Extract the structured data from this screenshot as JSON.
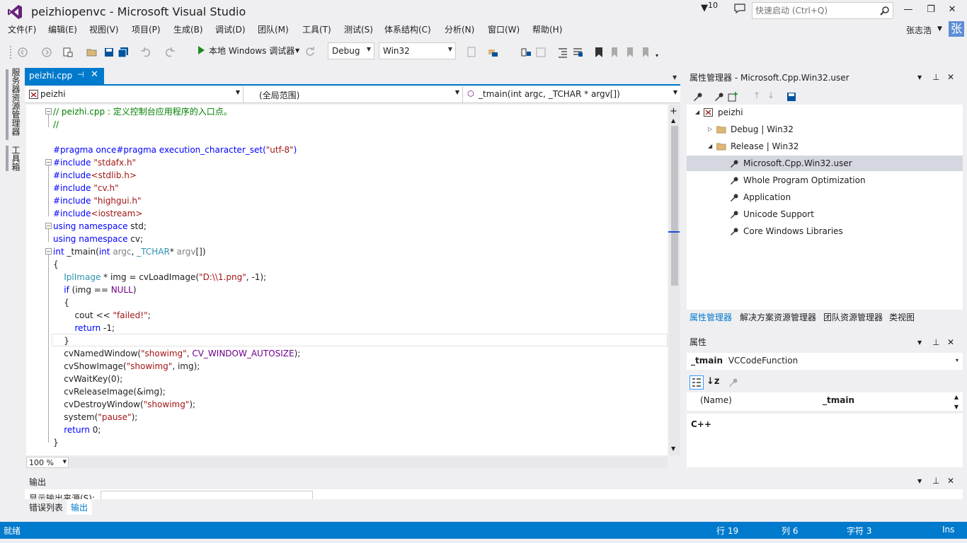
{
  "window": {
    "title": "peizhiopenvc - Microsoft Visual Studio",
    "notification_count": "10",
    "quick_launch_placeholder": "快速启动 (Ctrl+Q)",
    "user_name": "张志浩",
    "avatar_text": "张",
    "min_label": "—",
    "max_label": "❐",
    "close_label": "✕"
  },
  "menu": {
    "items": [
      "文件(F)",
      "编辑(E)",
      "视图(V)",
      "项目(P)",
      "生成(B)",
      "调试(D)",
      "团队(M)",
      "工具(T)",
      "测试(S)",
      "体系结构(C)",
      "分析(N)",
      "窗口(W)",
      "帮助(H)"
    ]
  },
  "toolbar": {
    "start_label": "本地 Windows 调试器",
    "configuration": "Debug",
    "platform": "Win32"
  },
  "left_tabs": [
    "服务器资源管理器",
    "工具箱"
  ],
  "document": {
    "tab_label": "peizhi.cpp",
    "pin_glyph": "⊣",
    "close_glyph": "✕",
    "nav_project": "peizhi",
    "nav_scope": "(全局范围)",
    "nav_member": "_tmain(int argc, _TCHAR * argv[])",
    "zoom": "100 %",
    "split_glyph": "+"
  },
  "code_lines": [
    [
      [
        "cm",
        "// peizhi.cpp : 定义控制台应用程序的入口点。"
      ]
    ],
    [
      [
        "cm",
        "//"
      ]
    ],
    [],
    [
      [
        "pp",
        "#pragma once"
      ],
      [
        "pp",
        "#pragma execution_character_set("
      ],
      [
        "str",
        "\"utf-8\""
      ],
      [
        "pp",
        ")"
      ]
    ],
    [
      [
        "pp",
        "#include "
      ],
      [
        "str",
        "\"stdafx.h\""
      ]
    ],
    [
      [
        "pp",
        "#include"
      ],
      [
        "str",
        "<stdlib.h>"
      ]
    ],
    [
      [
        "pp",
        "#include "
      ],
      [
        "str",
        "\"cv.h\""
      ]
    ],
    [
      [
        "pp",
        "#include "
      ],
      [
        "str",
        "\"highgui.h\""
      ]
    ],
    [
      [
        "pp",
        "#include"
      ],
      [
        "str",
        "<iostream>"
      ]
    ],
    [
      [
        "kw",
        "using namespace "
      ],
      [
        "",
        "std;"
      ]
    ],
    [
      [
        "kw",
        "using namespace "
      ],
      [
        "",
        "cv;"
      ]
    ],
    [
      [
        "kw",
        "int "
      ],
      [
        "",
        "_tmain("
      ],
      [
        "kw",
        "int "
      ],
      [
        "pm",
        "argc"
      ],
      [
        "",
        ", "
      ],
      [
        "ty",
        "_TCHAR"
      ],
      [
        "",
        "* "
      ],
      [
        "pm",
        "argv"
      ],
      [
        "",
        "[])"
      ]
    ],
    [
      [
        "",
        "{"
      ]
    ],
    [
      [
        "ty",
        "    IplImage"
      ],
      [
        "",
        " * img = cvLoadImage("
      ],
      [
        "str",
        "\"D:\\\\1.png\""
      ],
      [
        "",
        ", -1);"
      ]
    ],
    [
      [
        "kw",
        "    if "
      ],
      [
        "",
        "(img == "
      ],
      [
        "mc",
        "NULL"
      ],
      [
        "",
        ")"
      ]
    ],
    [
      [
        "",
        "    {"
      ]
    ],
    [
      [
        "",
        "        cout << "
      ],
      [
        "str",
        "\"failed!\""
      ],
      [
        "",
        ";"
      ]
    ],
    [
      [
        "kw",
        "        return "
      ],
      [
        "",
        "-1;"
      ]
    ],
    [
      [
        "",
        "    }"
      ]
    ],
    [
      [
        "",
        "    cvNamedWindow("
      ],
      [
        "str",
        "\"showimg\""
      ],
      [
        "",
        ", "
      ],
      [
        "mc",
        "CV_WINDOW_AUTOSIZE"
      ],
      [
        "",
        ");"
      ]
    ],
    [
      [
        "",
        "    cvShowImage("
      ],
      [
        "str",
        "\"showimg\""
      ],
      [
        "",
        ", img);"
      ]
    ],
    [
      [
        "",
        "    cvWaitKey(0);"
      ]
    ],
    [
      [
        "",
        "    cvReleaseImage(&img);"
      ]
    ],
    [
      [
        "",
        "    cvDestroyWindow("
      ],
      [
        "str",
        "\"showimg\""
      ],
      [
        "",
        ");"
      ]
    ],
    [
      [
        "",
        "    system("
      ],
      [
        "str",
        "\"pause\""
      ],
      [
        "",
        ");"
      ]
    ],
    [
      [
        "kw",
        "    return "
      ],
      [
        "",
        "0;"
      ]
    ],
    [
      [
        "",
        "}"
      ]
    ]
  ],
  "property_manager": {
    "title": "属性管理器 - Microsoft.Cpp.Win32.user",
    "tree": [
      {
        "label": "peizhi",
        "level": 0,
        "icon": "project-icon",
        "expand": "◢"
      },
      {
        "label": "Debug | Win32",
        "level": 1,
        "icon": "folder-icon",
        "expand": "▷"
      },
      {
        "label": "Release | Win32",
        "level": 1,
        "icon": "folder-open-icon",
        "expand": "◢"
      },
      {
        "label": "Microsoft.Cpp.Win32.user",
        "level": 2,
        "icon": "wrench-icon",
        "expand": "",
        "selected": true
      },
      {
        "label": "Whole Program Optimization",
        "level": 2,
        "icon": "wrench-icon",
        "expand": ""
      },
      {
        "label": "Application",
        "level": 2,
        "icon": "wrench-icon",
        "expand": ""
      },
      {
        "label": "Unicode Support",
        "level": 2,
        "icon": "wrench-icon",
        "expand": ""
      },
      {
        "label": "Core Windows Libraries",
        "level": 2,
        "icon": "wrench-icon",
        "expand": ""
      }
    ],
    "tabs": [
      "属性管理器",
      "解决方案资源管理器",
      "团队资源管理器",
      "类视图"
    ]
  },
  "properties": {
    "title": "属性",
    "object_name": "_tmain",
    "object_type": "VCCodeFunction",
    "row_name": "(Name)",
    "row_value": "_tmain",
    "description": "C++"
  },
  "output": {
    "title": "输出",
    "source_label": "显示输出来源(S):",
    "tabs": [
      "错误列表",
      "输出"
    ]
  },
  "status": {
    "ready": "就绪",
    "line": "行 19",
    "col": "列 6",
    "char": "字符 3",
    "mode": "Ins"
  },
  "colors": {
    "accent": "#007acc",
    "keyword": "#0000ff",
    "string": "#a31515",
    "comment": "#008000",
    "type": "#2b91af",
    "macro": "#6f008a",
    "selected_row": "#d4d6e0"
  }
}
